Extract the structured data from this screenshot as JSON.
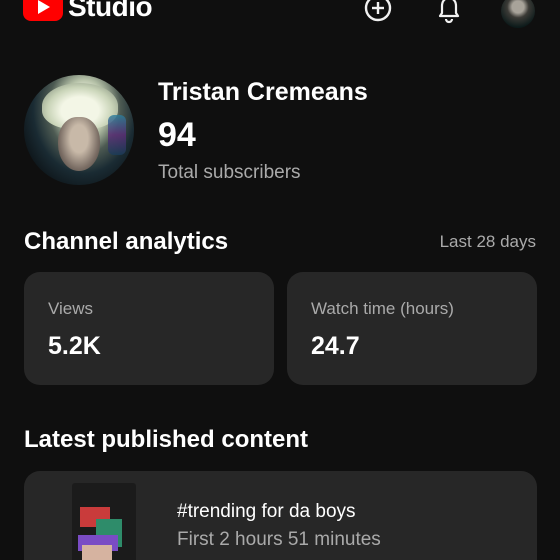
{
  "header": {
    "logo_text": "Studio",
    "create_icon": "add-circle-icon",
    "notifications_icon": "bell-icon",
    "account_icon": "avatar"
  },
  "channel": {
    "name": "Tristan Cremeans",
    "subscriber_count": "94",
    "subscriber_label": "Total subscribers"
  },
  "analytics": {
    "title": "Channel analytics",
    "period": "Last 28 days",
    "cards": [
      {
        "label": "Views",
        "value": "5.2K"
      },
      {
        "label": "Watch time (hours)",
        "value": "24.7"
      }
    ]
  },
  "latest": {
    "title": "Latest published content",
    "item": {
      "title": "#trending for da boys",
      "meta": "First 2 hours 51 minutes"
    }
  },
  "colors": {
    "background": "#0f0f0f",
    "card": "#272727",
    "brand": "#ff0000",
    "secondary_text": "#aaaaaa"
  }
}
